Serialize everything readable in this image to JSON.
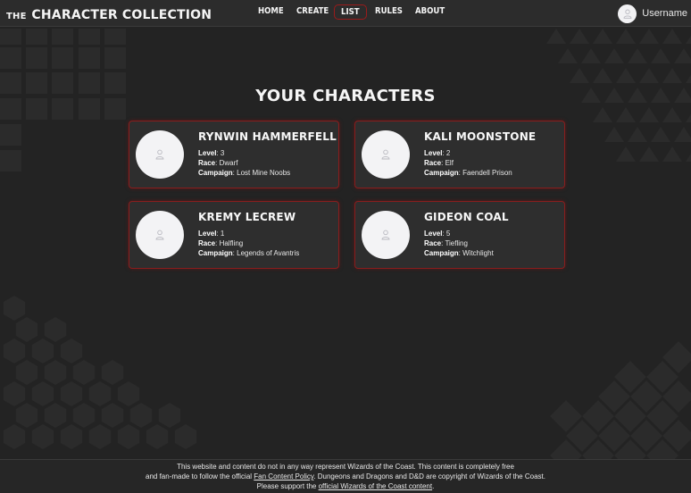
{
  "header": {
    "brand_prefix": "THE",
    "brand_main": "CHARACTER COLLECTION",
    "nav": [
      {
        "label": "HOME"
      },
      {
        "label": "CREATE"
      },
      {
        "label": "LIST"
      },
      {
        "label": "RULES"
      },
      {
        "label": "ABOUT"
      }
    ],
    "active_nav": "LIST",
    "username": "Username",
    "avatar_icon": "user-icon"
  },
  "main": {
    "title": "YOUR CHARACTERS",
    "field_labels": {
      "level": "Level",
      "race": "Race",
      "campaign": "Campaign"
    },
    "characters": [
      {
        "name": "RYNWIN HAMMERFELL",
        "level": "3",
        "race": "Dwarf",
        "campaign": "Lost Mine Noobs"
      },
      {
        "name": "KALI MOONSTONE",
        "level": "2",
        "race": "Elf",
        "campaign": "Faendell Prison"
      },
      {
        "name": "KREMY LECREW",
        "level": "1",
        "race": "Halfling",
        "campaign": "Legends of Avantris"
      },
      {
        "name": "GIDEON COAL",
        "level": "5",
        "race": "Tiefling",
        "campaign": "Witchlight"
      }
    ]
  },
  "footer": {
    "line1": "This website and content do not in any way represent Wizards of the Coast. This content is completely free",
    "line2_pre": "and fan-made to follow the official ",
    "line2_link": "Fan Content Policy",
    "line2_post": ". Dungeons and Dragons and D&D are copyright of Wizards of the Coast.",
    "line3_pre": "Please support the ",
    "line3_link": "official Wizards of the Coast content",
    "line3_post": "."
  },
  "colors": {
    "background": "#232323",
    "card": "#2e2e2e",
    "accent": "#8a1d1d",
    "header": "#2c2c2c"
  }
}
